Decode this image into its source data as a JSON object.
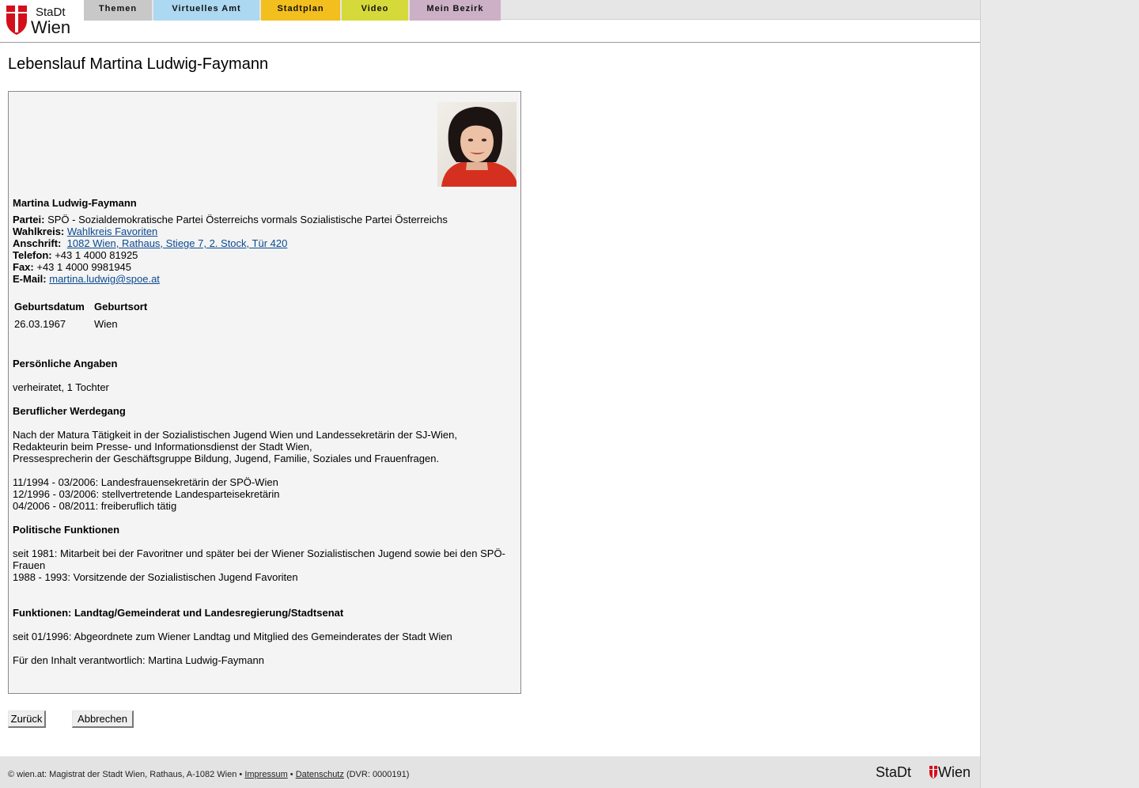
{
  "brand": {
    "line1": "StaDt",
    "line2": "Wien",
    "footer_left": "StaDt",
    "footer_right": "Wien"
  },
  "nav": [
    {
      "label": "Themen",
      "color": "#c8c8c8"
    },
    {
      "label": "Virtuelles Amt",
      "color": "#acd8f1"
    },
    {
      "label": "Stadtplan",
      "color": "#f2bf1e"
    },
    {
      "label": "Video",
      "color": "#d6d93a"
    },
    {
      "label": "Mein Bezirk",
      "color": "#cbb0c6"
    }
  ],
  "page_title": "Lebenslauf Martina Ludwig-Faymann",
  "profile": {
    "name": "Martina Ludwig-Faymann",
    "partei_label": "Partei:",
    "partei": "SPÖ - Sozialdemokratische Partei Österreichs vormals Sozialistische Partei Österreichs",
    "wahlkreis_label": "Wahlkreis:",
    "wahlkreis": "Wahlkreis Favoriten",
    "anschrift_label": "Anschrift:",
    "anschrift": "1082 Wien, Rathaus, Stiege 7, 2. Stock, Tür 420",
    "telefon_label": "Telefon:",
    "telefon": "+43 1 4000 81925",
    "fax_label": "Fax:",
    "fax": "+43 1 4000 9981945",
    "email_label": "E-Mail:",
    "email": "martina.ludwig@spoe.at"
  },
  "birth_table": {
    "headers": [
      "Geburtsdatum",
      "Geburtsort"
    ],
    "row": [
      "26.03.1967",
      "Wien"
    ]
  },
  "sections": {
    "personal_heading": "Persönliche Angaben",
    "personal_text": "verheiratet, 1 Tochter",
    "career_heading": "Beruflicher Werdegang",
    "career_lines": [
      "Nach der Matura Tätigkeit in der Sozialistischen Jugend Wien und Landessekretärin der SJ-Wien,",
      "Redakteurin beim Presse- und Informationsdienst der Stadt Wien,",
      "Pressesprecherin der Geschäftsgruppe Bildung, Jugend, Familie, Soziales und Frauenfragen.",
      "11/1994 - 03/2006: Landesfrauensekretärin der SPÖ-Wien",
      "12/1996 - 03/2006: stellvertretende Landesparteisekretärin",
      "04/2006 - 08/2011: freiberuflich tätig"
    ],
    "political_heading": "Politische Funktionen",
    "political_lines": [
      "seit 1981: Mitarbeit bei der Favoritner und später bei der Wiener Sozialistischen Jugend sowie bei den SPÖ-",
      "Frauen",
      "1988 - 1993: Vorsitzende der Sozialistischen Jugend Favoriten"
    ],
    "functions_heading": "Funktionen: Landtag/Gemeinderat und Landesregierung/Stadtsenat",
    "functions_text": "seit 01/1996: Abgeordnete zum Wiener Landtag und Mitglied des Gemeinderates der Stadt Wien",
    "responsible": "Für den Inhalt verantwortlich: Martina Ludwig-Faymann"
  },
  "buttons": {
    "back": "Zurück",
    "cancel": "Abbrechen"
  },
  "footer": {
    "text_prefix": "© wien.at: Magistrat der Stadt Wien, Rathaus, A-1082 Wien •",
    "impressum": "Impressum",
    "sep": "•",
    "datenschutz": "Datenschutz",
    "dvr": "(DVR: 0000191)"
  },
  "colors": {
    "wien_red": "#d40f1c",
    "link": "#0b4a91"
  }
}
